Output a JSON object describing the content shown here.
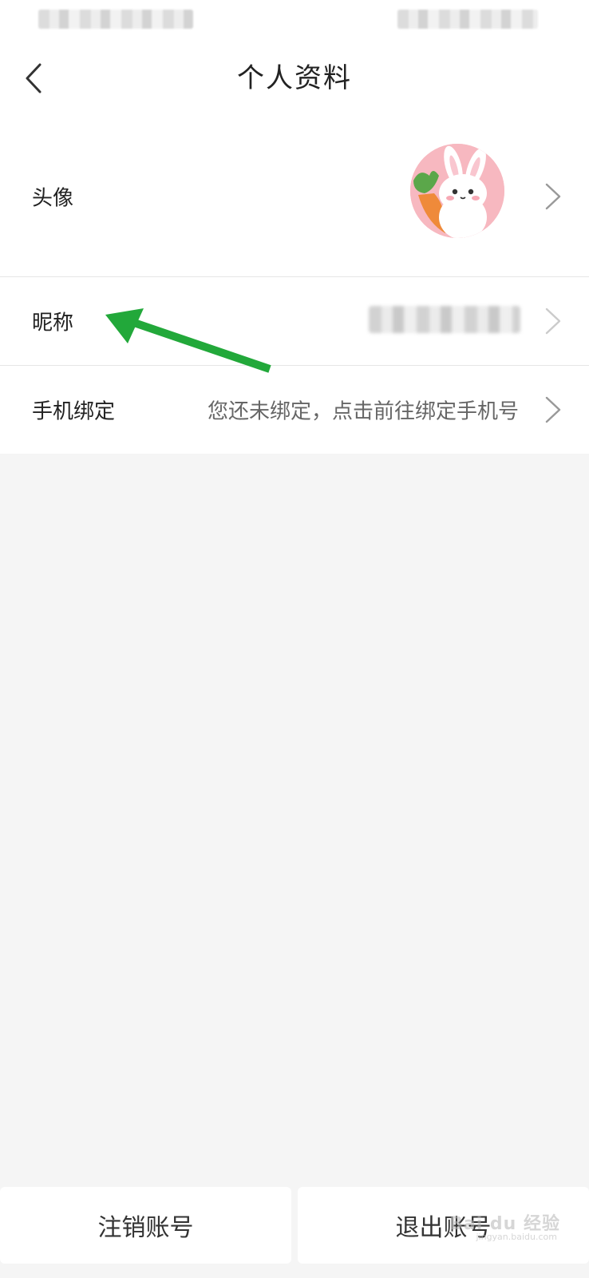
{
  "header": {
    "title": "个人资料"
  },
  "rows": [
    {
      "label": "头像",
      "value": ""
    },
    {
      "label": "昵称",
      "value": ""
    },
    {
      "label": "手机绑定",
      "value": "您还未绑定，点击前往绑定手机号"
    }
  ],
  "footer": {
    "deactivate_label": "注销账号",
    "logout_label": "退出账号"
  },
  "watermark": {
    "text": "Bai du 经验",
    "url": "jingyan.baidu.com"
  },
  "colors": {
    "accent_arrow": "#22a83a",
    "avatar_bg": "#f7b8c0",
    "page_bg": "#f5f5f5"
  },
  "icons": {
    "back": "chevron-left-icon",
    "row_chevron": "chevron-right-icon"
  }
}
